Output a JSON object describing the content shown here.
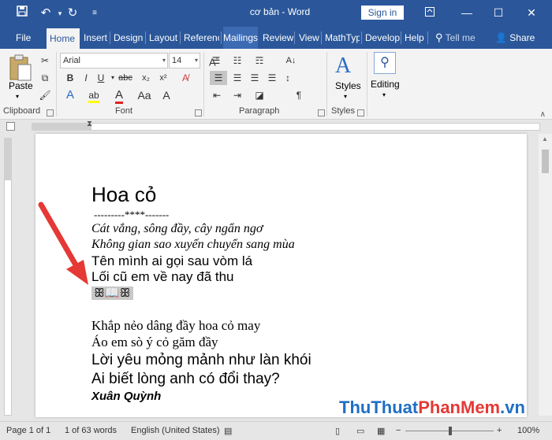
{
  "titlebar": {
    "title": "cơ bản  -  Word",
    "signin": "Sign in",
    "colors": {
      "bg": "#2b579a"
    }
  },
  "tabs": [
    {
      "label": "File"
    },
    {
      "label": "Home",
      "active": true
    },
    {
      "label": "Insert"
    },
    {
      "label": "Design"
    },
    {
      "label": "Layout"
    },
    {
      "label": "Referenc"
    },
    {
      "label": "Mailings"
    },
    {
      "label": "Review"
    },
    {
      "label": "View"
    },
    {
      "label": "MathTyp"
    },
    {
      "label": "Develop"
    },
    {
      "label": "Help"
    }
  ],
  "tellme": "Tell me",
  "share": "Share",
  "ribbon": {
    "clipboard": {
      "paste": "Paste",
      "label": "Clipboard"
    },
    "font": {
      "name": "Arial",
      "size": "14",
      "label": "Font"
    },
    "paragraph": {
      "label": "Paragraph"
    },
    "styles": {
      "btn": "Styles",
      "label": "Styles"
    },
    "editing": {
      "btn": "Editing"
    }
  },
  "document": {
    "title": "Hoa cỏ",
    "separator": "---------****-------",
    "lines": [
      "Cát vắng, sông đầy, cây ngẩn ngơ",
      "Không gian sao xuyến chuyển sang mùa",
      "Tên mình ai gọi sau vòm lá",
      "Lối cũ em về nay đã thu",
      "ꕥ📖ꕥ",
      "Khắp nẻo dâng đầy hoa cỏ may",
      "Áo em sò ý cỏ găm đầy",
      "Lời yêu mỏng mảnh như làn khói",
      "Ai biết lòng anh có đổi thay?"
    ],
    "author": "Xuân Quỳnh"
  },
  "status": {
    "page": "Page 1 of 1",
    "words": "1 of 63 words",
    "language": "English (United States)",
    "zoom": "100%"
  },
  "watermark": {
    "part1": "ThuThuat",
    "part2": "PhanMem",
    "part3": ".vn"
  }
}
